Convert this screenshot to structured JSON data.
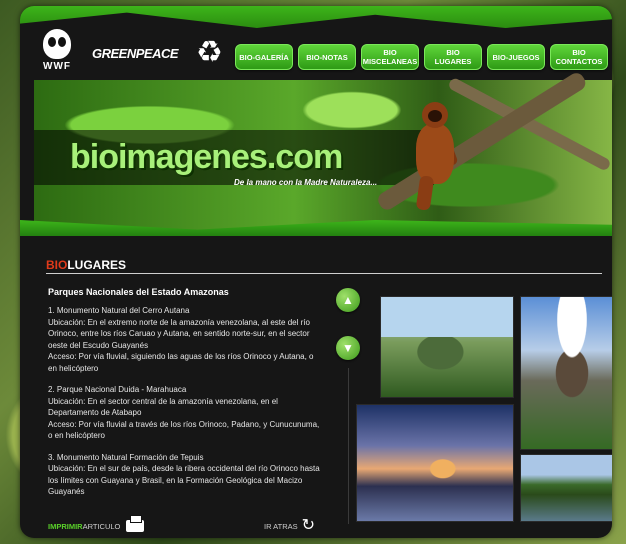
{
  "header": {
    "logo_wwf": "WWF",
    "logo_greenpeace": "GREENPEACE",
    "recycle_symbol": "♻"
  },
  "nav": [
    {
      "label": "BIO-GALERÍA"
    },
    {
      "label": "BIO-NOTAS"
    },
    {
      "label": "BIO\nMISCELANEAS"
    },
    {
      "label": "BIO\nLUGARES"
    },
    {
      "label": "BIO-JUEGOS"
    },
    {
      "label": "BIO\nCONTACTOS"
    }
  ],
  "banner": {
    "brand": "bioimagenes.com",
    "tagline": "De la mano con la  Madre Naturaleza..."
  },
  "section": {
    "title_prefix": "BIO",
    "title_suffix": "LUGARES"
  },
  "article": {
    "title": "Parques Nacionales del Estado Amazonas",
    "paragraphs": [
      "1. Monumento Natural del Cerro Autana\nUbicación: En el extremo norte de la amazonía venezolana, al este del río Orinoco, entre los ríos Caruao y Autana, en sentido norte-sur, en el sector oeste del Escudo Guayanés\nAcceso: Por vía fluvial, siguiendo las aguas de los ríos Orinoco y Autana, o en helicóptero",
      "2. Parque Nacional Duida - Marahuaca\nUbicación: En el sector central de la amazonía venezolana, en el Departamento de Atabapo\nAcceso: Por vía fluvial a través de los ríos Orinoco, Padano, y Cunucunuma, o en helicóptero",
      "3. Monumento Natural Formación de Tepuis\nUbicación: En el sur de país, desde la ribera occidental del río Orinoco hasta los límites con Guayana y Brasil, en la Formación Geológica del Macizo Guayanés"
    ]
  },
  "scroll": {
    "up_icon": "▲",
    "down_icon": "▼"
  },
  "footer": {
    "print_highlight": "IMPRIMIR",
    "print_text": "ARTICULO",
    "back_label": "IR ATRAS",
    "back_icon": "↻"
  },
  "colors": {
    "accent_green": "#3db51a",
    "title_red": "#e03a1a",
    "panel_bg": "#161616"
  }
}
